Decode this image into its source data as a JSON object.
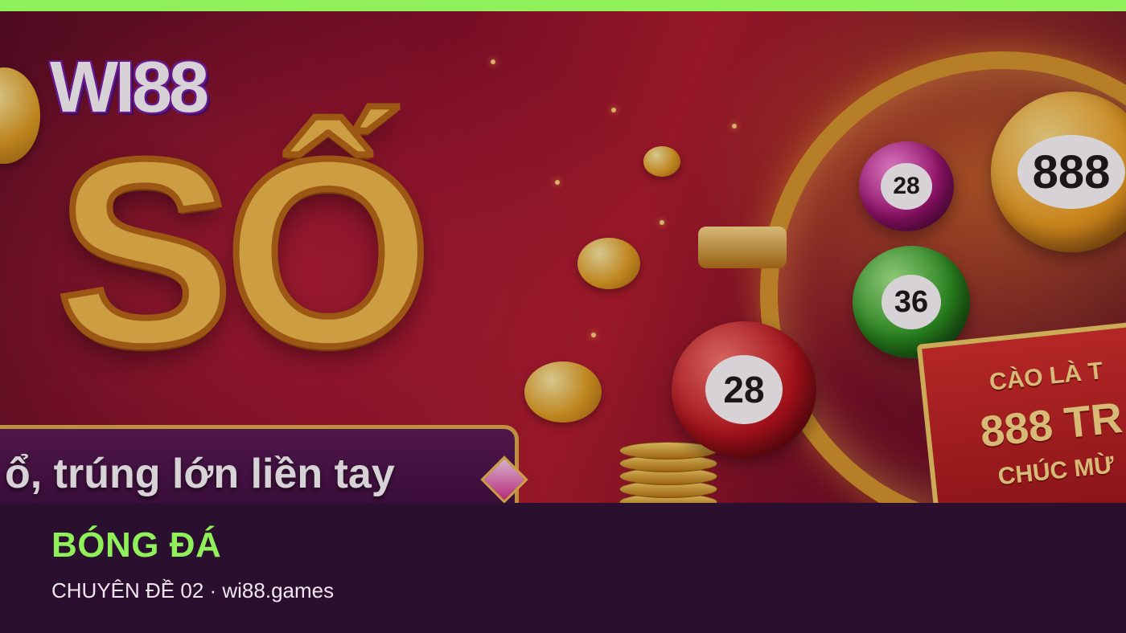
{
  "colors": {
    "accent": "#8ff05a",
    "caption_background": "#2a0f2e",
    "caption_text": "#f1e6f0"
  },
  "banner": {
    "logo_text": "WI88",
    "title_word": "SỐ",
    "tagline": "ổ, trúng lớn liền tay",
    "balls": [
      "28",
      "28",
      "36",
      "888"
    ],
    "ticket": {
      "line1": "CÀO LÀ T",
      "line2": "888 TR",
      "line3": "CHÚC MỪ"
    }
  },
  "caption": {
    "headline": "BÓNG ĐÁ",
    "subline": "CHUYÊN ĐỀ 02 · wi88.games"
  }
}
